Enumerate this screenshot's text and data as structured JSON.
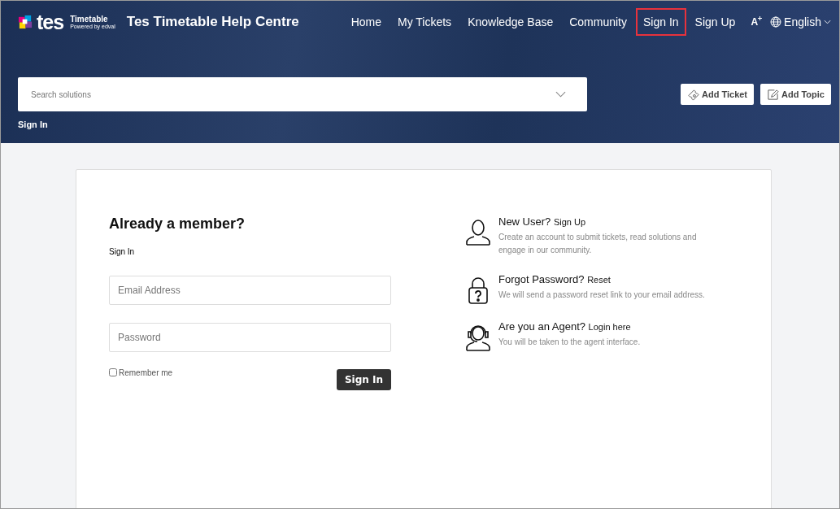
{
  "header": {
    "logo": {
      "wordmark": "tes",
      "product": "Timetable",
      "tagline": "Powered by edval"
    },
    "title": "Tes Timetable Help Centre",
    "nav": [
      {
        "label": "Home",
        "highlighted": false
      },
      {
        "label": "My Tickets",
        "highlighted": false
      },
      {
        "label": "Knowledge Base",
        "highlighted": false
      },
      {
        "label": "Community",
        "highlighted": false
      },
      {
        "label": "Sign In",
        "highlighted": true
      },
      {
        "label": "Sign Up",
        "highlighted": false
      }
    ],
    "font_size_label": "A",
    "language": "English",
    "search": {
      "placeholder": "Search solutions"
    },
    "actions": [
      {
        "label": "Add Ticket",
        "kind": "ticket"
      },
      {
        "label": "Add Topic",
        "kind": "topic"
      }
    ],
    "breadcrumb": "Sign In"
  },
  "login": {
    "title": "Already a member?",
    "subtitle": "Sign In",
    "email": {
      "placeholder": "Email Address"
    },
    "password": {
      "placeholder": "Password"
    },
    "remember": {
      "label": "Remember me",
      "checked": false
    },
    "submit": "Sign In"
  },
  "options": [
    {
      "kind": "user",
      "title": "New User?",
      "link": "Sign Up",
      "text": "Create an account to submit tickets, read solutions and engage in our community."
    },
    {
      "kind": "lock",
      "title": "Forgot Password?",
      "link": "Reset",
      "text": "We will send a password reset link to your email address."
    },
    {
      "kind": "agent",
      "title": "Are you an Agent?",
      "link": "Login here",
      "text": "You will be taken to the agent interface."
    }
  ]
}
